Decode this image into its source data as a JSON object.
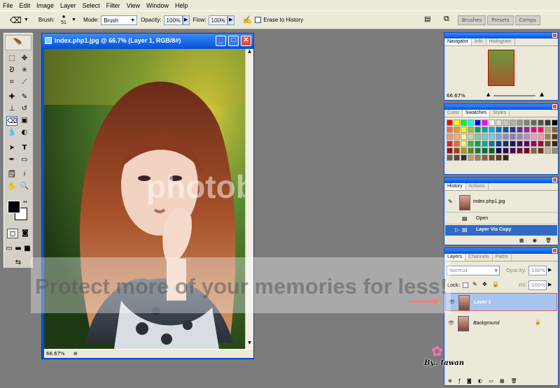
{
  "menu": [
    "File",
    "Edit",
    "Image",
    "Layer",
    "Select",
    "Filter",
    "View",
    "Window",
    "Help"
  ],
  "options": {
    "brush_label": "Brush:",
    "brush_size": "51",
    "mode_label": "Mode:",
    "mode_value": "Brush",
    "opacity_label": "Opacity:",
    "opacity_value": "100%",
    "flow_label": "Flow:",
    "flow_value": "100%",
    "erase_history": "Erase to History",
    "wells": [
      "Brushes",
      "Presets",
      "Comps"
    ]
  },
  "document": {
    "title": "index.php1.jpg @ 66.7% (Layer 1, RGB/8#)",
    "zoom": "66.67%"
  },
  "navigator": {
    "tabs": [
      "Navigator",
      "Info",
      "Histogram"
    ],
    "zoom": "66.67%"
  },
  "color_panel": {
    "tabs": [
      "Color",
      "Swatches",
      "Styles"
    ],
    "swatches": [
      "#ff0000",
      "#ffff00",
      "#00ff00",
      "#00ffff",
      "#0000ff",
      "#ff00ff",
      "#ffffff",
      "#e0e0e0",
      "#c8c8c8",
      "#b0b0b0",
      "#989898",
      "#808080",
      "#686868",
      "#505050",
      "#383838",
      "#000000",
      "#f26c4f",
      "#f7941d",
      "#fff200",
      "#8dc63f",
      "#00a651",
      "#00a99d",
      "#00aeef",
      "#0072bc",
      "#0054a6",
      "#2e3192",
      "#662d91",
      "#92278f",
      "#ec008c",
      "#ed145b",
      "#c69c6d",
      "#8c6239",
      "#f7977a",
      "#fbaf5d",
      "#fff79a",
      "#c4df9b",
      "#82ca9c",
      "#7accc8",
      "#6dcff6",
      "#7da7d9",
      "#8393ca",
      "#8781bd",
      "#a187be",
      "#bd8cbf",
      "#f49ac2",
      "#f6989d",
      "#a67c52",
      "#603913",
      "#ed1c24",
      "#f26522",
      "#fff568",
      "#39b54a",
      "#00a651",
      "#00a99d",
      "#0076a3",
      "#004a80",
      "#003471",
      "#1b1464",
      "#440e62",
      "#630460",
      "#9e005d",
      "#9e0039",
      "#754c24",
      "#3c2415",
      "#9e0b0f",
      "#a0410d",
      "#aba000",
      "#598527",
      "#197b30",
      "#007236",
      "#005e20",
      "#0d004c",
      "#32004b",
      "#4b0049",
      "#7b0046",
      "#7a0026",
      "#8c6239",
      "#603913",
      "#c7b299",
      "#998675",
      "#736357",
      "#534741",
      "#362f2d",
      "#c69c6d",
      "#a67c52",
      "#8c6239",
      "#754c24",
      "#603913",
      "#3c2415"
    ]
  },
  "history": {
    "tabs": [
      "History",
      "Actions"
    ],
    "snapshot": "index.php1.jpg",
    "items": [
      "Open",
      "Layer Via Copy"
    ]
  },
  "layers": {
    "tabs": [
      "Layers",
      "Channels",
      "Paths"
    ],
    "blend_mode": "Normal",
    "opacity_label": "Opacity:",
    "opacity_value": "100%",
    "lock_label": "Lock:",
    "fill_label": "Fill:",
    "fill_value": "100%",
    "items": [
      "Layer 1",
      "Background"
    ]
  },
  "watermarks": {
    "main": "photobucket",
    "protect": "Protect more of your memories for less!",
    "signature": "By.. tawan"
  },
  "colors": {
    "accent": "#0a4fd9",
    "panel_bg": "#ece9d8",
    "selection": "#316ac5"
  }
}
